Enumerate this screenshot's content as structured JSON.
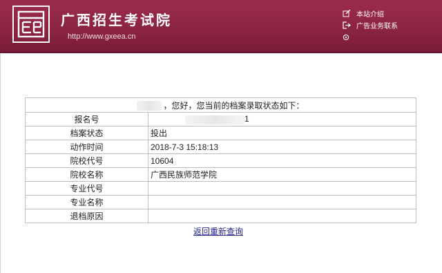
{
  "header": {
    "site_title": "广西招生考试院",
    "site_url": "http://www.gxeea.cn",
    "links": [
      {
        "label": "本站介绍",
        "icon": "edit-icon"
      },
      {
        "label": "广告业务联系",
        "icon": "exit-icon"
      },
      {
        "label": "",
        "icon": "home-icon"
      }
    ]
  },
  "result": {
    "greeting": "，您好，您当前的档案录取状态如下：",
    "rows": [
      {
        "label": "报名号",
        "value": "1"
      },
      {
        "label": "档案状态",
        "value": "投出"
      },
      {
        "label": "动作时间",
        "value": "2018-7-3 15:18:13"
      },
      {
        "label": "院校代号",
        "value": "10604"
      },
      {
        "label": "院校名称",
        "value": "广西民族师范学院"
      },
      {
        "label": "专业代号",
        "value": ""
      },
      {
        "label": "专业名称",
        "value": ""
      },
      {
        "label": "退档原因",
        "value": ""
      }
    ]
  },
  "back_link": "返回重新查询",
  "colors": {
    "header_bg": "#8a2342",
    "link": "#23238e",
    "border": "#bdbdbd"
  }
}
